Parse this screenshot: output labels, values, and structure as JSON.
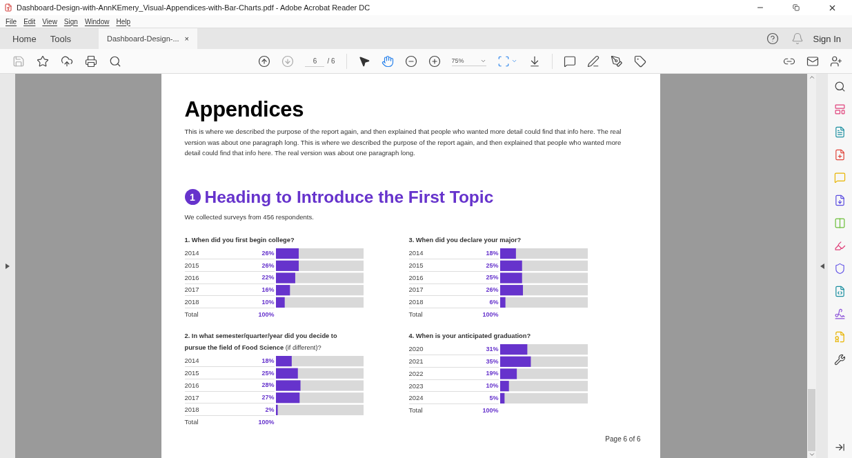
{
  "window": {
    "title": "Dashboard-Design-with-AnnKEmery_Visual-Appendices-with-Bar-Charts.pdf - Adobe Acrobat Reader DC"
  },
  "menu": [
    "File",
    "Edit",
    "View",
    "Sign",
    "Window",
    "Help"
  ],
  "tabs": [
    {
      "label": "Home",
      "selected": false
    },
    {
      "label": "Tools",
      "selected": false
    },
    {
      "label": "Dashboard-Design-...",
      "selected": true,
      "kind": "document",
      "close": "×"
    }
  ],
  "sign_in": "Sign In",
  "toolbar": {
    "previous_disabled": false,
    "next_disabled": true,
    "page": "6",
    "page_total": "/ 6",
    "zoom": "75%",
    "tools": [
      {
        "kind": "select",
        "selected": false
      },
      {
        "kind": "hand",
        "selected": true
      }
    ]
  },
  "document": {
    "title": "Appendices",
    "intro": "This is where we described the purpose of the report again, and then explained that people who wanted more detail could find that info here. The real version was about one paragraph long. This is where we described the purpose of the report again, and then explained that people who wanted more detail could find that info here. The real version was about one paragraph long.",
    "section_number": "1",
    "heading": "Heading to Introduce the First Topic",
    "subtitle": "We collected surveys from 456 respondents.",
    "charts": [
      {
        "question": "**1. When did you first begin college?**",
        "total_label": "Total",
        "total_value": "100%",
        "chart_data": {
          "type": "bar",
          "orientation": "horizontal",
          "categories": [
            "2014",
            "2015",
            "2016",
            "2017",
            "2018"
          ],
          "values": [
            26,
            26,
            22,
            16,
            10
          ],
          "xlim": [
            0,
            100
          ],
          "value_labels": [
            "26%",
            "26%",
            "22%",
            "16%",
            "10%"
          ]
        }
      },
      {
        "question": "**3. When did you declare your major?**",
        "total_label": "Total",
        "total_value": "100%",
        "chart_data": {
          "type": "bar",
          "orientation": "horizontal",
          "categories": [
            "2014",
            "2015",
            "2016",
            "2017",
            "2018"
          ],
          "values": [
            18,
            25,
            25,
            26,
            6
          ],
          "xlim": [
            0,
            100
          ],
          "value_labels": [
            "18%",
            "25%",
            "25%",
            "26%",
            "6%"
          ]
        }
      },
      {
        "question": "**2. In what semester/quarter/year did you decide to pursue the field of Food Science** (if different)?",
        "total_label": "Total",
        "total_value": "100%",
        "chart_data": {
          "type": "bar",
          "orientation": "horizontal",
          "categories": [
            "2014",
            "2015",
            "2016",
            "2017",
            "2018"
          ],
          "values": [
            18,
            25,
            28,
            27,
            2
          ],
          "xlim": [
            0,
            100
          ],
          "value_labels": [
            "18%",
            "25%",
            "28%",
            "27%",
            "2%"
          ]
        }
      },
      {
        "question": "**4. When is your anticipated graduation?**",
        "total_label": "Total",
        "total_value": "100%",
        "chart_data": {
          "type": "bar",
          "orientation": "horizontal",
          "categories": [
            "2020",
            "2021",
            "2022",
            "2023",
            "2024"
          ],
          "values": [
            31,
            35,
            19,
            10,
            5
          ],
          "xlim": [
            0,
            100
          ],
          "value_labels": [
            "31%",
            "35%",
            "19%",
            "10%",
            "5%"
          ]
        }
      }
    ],
    "footer": "Page 6 of 6"
  }
}
